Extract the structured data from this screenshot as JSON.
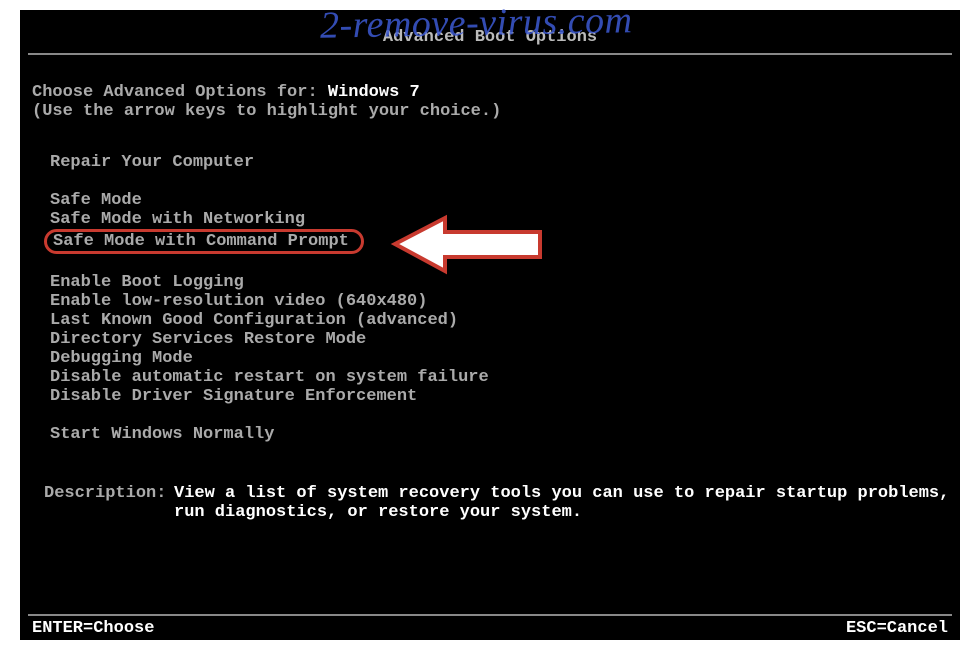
{
  "title": "Advanced Boot Options",
  "choose_prefix": "Choose Advanced Options for: ",
  "os_name": "Windows 7",
  "hint": "(Use the arrow keys to highlight your choice.)",
  "menu": {
    "group1": [
      "Repair Your Computer"
    ],
    "group2": [
      "Safe Mode",
      "Safe Mode with Networking",
      "Safe Mode with Command Prompt"
    ],
    "group3": [
      "Enable Boot Logging",
      "Enable low-resolution video (640x480)",
      "Last Known Good Configuration (advanced)",
      "Directory Services Restore Mode",
      "Debugging Mode",
      "Disable automatic restart on system failure",
      "Disable Driver Signature Enforcement"
    ],
    "group4": [
      "Start Windows Normally"
    ]
  },
  "highlighted_index": {
    "group": "group2",
    "i": 2
  },
  "description_label": "Description:",
  "description_text": "View a list of system recovery tools you can use to repair startup problems, run diagnostics, or restore your system.",
  "footer_left": "ENTER=Choose",
  "footer_right": "ESC=Cancel",
  "watermark": "2-remove-virus.com",
  "annotation_color": "#c83a2f"
}
